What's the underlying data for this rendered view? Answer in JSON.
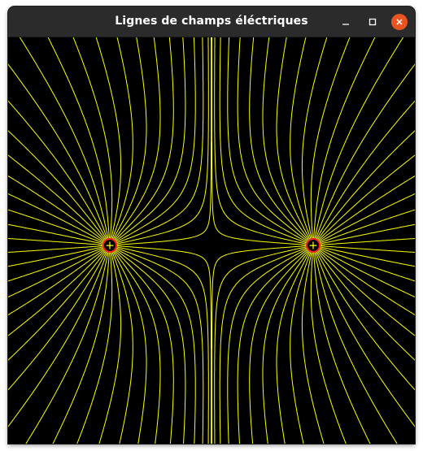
{
  "window": {
    "title": "Lignes de champs éléctriques",
    "controls": [
      {
        "name": "minimize",
        "icon": "minimize-icon"
      },
      {
        "name": "maximize",
        "icon": "maximize-icon"
      },
      {
        "name": "close",
        "icon": "close-icon"
      }
    ],
    "close_color": "#e95420",
    "titlebar_color": "#2b2b2b"
  },
  "scene": {
    "background": "#000000",
    "line_color": "#ffff00",
    "charge_outline_color": "#ff2020",
    "charges": [
      {
        "sign": "+",
        "label": "+"
      },
      {
        "sign": "+",
        "label": "+"
      }
    ]
  }
}
